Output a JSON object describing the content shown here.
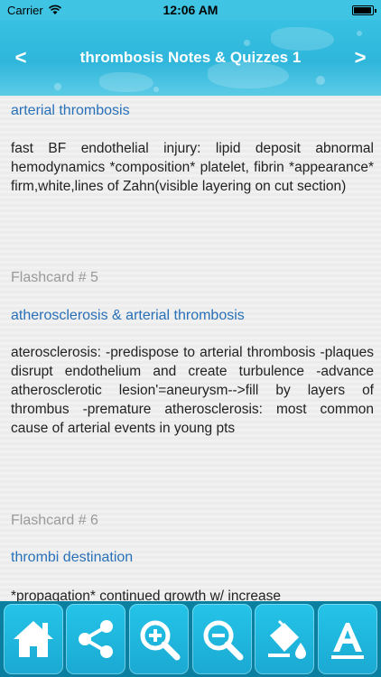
{
  "status": {
    "carrier": "Carrier",
    "time": "12:06 AM"
  },
  "nav": {
    "back": "<",
    "title": "thrombosis Notes & Quizzes 1",
    "forward": ">"
  },
  "cards": [
    {
      "question": "arterial thrombosis",
      "answer": "fast BF endothelial injury: lipid deposit abnormal hemodynamics *composition* platelet, fibrin *appearance* firm,white,lines of Zahn(visible layering on cut section)"
    },
    {
      "label": "Flashcard # 5",
      "question": "atherosclerosis & arterial thrombosis",
      "answer": "aterosclerosis: -predispose to arterial thrombosis -plaques disrupt endothelium and create turbulence -advance atherosclerotic lesion'=aneurysm-->fill by layers of thrombus -premature atherosclerosis: most common cause of arterial events in young pts"
    },
    {
      "label": "Flashcard # 6",
      "question": "thrombi destination",
      "answer": "*propagation* continued growth w/ increase"
    }
  ],
  "toolbar": {
    "icons": [
      "home-icon",
      "share-icon",
      "zoom-in-icon",
      "zoom-out-icon",
      "paint-bucket-icon",
      "font-icon"
    ],
    "accent": "#1fb8e0"
  }
}
